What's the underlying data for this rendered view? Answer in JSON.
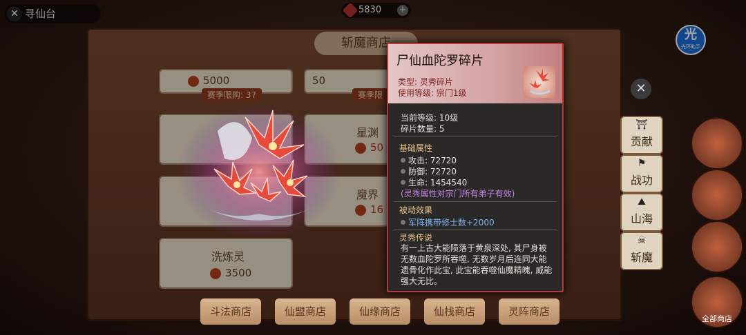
{
  "top": {
    "back_label": "寻仙台",
    "currency_value": "5830",
    "helper": {
      "glyph": "光",
      "label": "光环助手"
    }
  },
  "shop": {
    "title": "斩魔商店",
    "cards": [
      {
        "name": "",
        "price": "5000",
        "limit": "赛季限购: 37"
      },
      {
        "name": "",
        "price": "50",
        "limit": "赛季限"
      },
      {
        "name": "星渊",
        "price": "50"
      },
      {
        "name": "魔界",
        "price": "16"
      },
      {
        "name": "洗炼灵",
        "price": "3500"
      }
    ],
    "bottom_tabs": [
      "斗法商店",
      "仙盟商店",
      "仙缘商店",
      "仙栈商店",
      "灵阵商店"
    ],
    "side_tabs": [
      "贡献",
      "战功",
      "山海",
      "斩魔"
    ],
    "right_circles": [
      "",
      "",
      "",
      "全部商店"
    ]
  },
  "tooltip": {
    "title": "尸仙血陀罗碎片",
    "type_label": "类型:",
    "type_value": "灵秀碎片",
    "use_level_label": "使用等级:",
    "use_level_value": "宗门1级",
    "current_level": "当前等级: 10级",
    "fragment_count": "碎片数量: 5",
    "base_attr_title": "基础属性",
    "attrs": [
      "攻击: 72720",
      "防御: 72720",
      "生命: 1454540"
    ],
    "attr_note": "(灵秀属性对宗门所有弟子有效)",
    "passive_title": "被动效果",
    "passive_value": "军阵携带修士数+2000",
    "lore_title": "灵秀传说",
    "lore_text": "有一上古大能陨落于黄泉深处, 其尸身被无数血陀罗所吞噬, 无数岁月后连同大能遗骨化作此宝, 此宝能吞噬仙魔精魄, 威能强大无比。"
  }
}
